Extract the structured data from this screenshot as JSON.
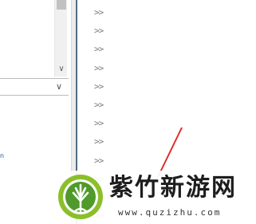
{
  "left_panel": {
    "scroll_down_glyph": "∨",
    "dropdown_arrow_glyph": "∨",
    "tiny_mark": "n"
  },
  "chevrons": [
    ">>",
    ">>",
    ">>",
    ">>",
    ">>",
    ">>",
    ">>",
    ">>",
    ">>",
    ">>",
    ">>",
    ">>"
  ],
  "watermark": {
    "name": "紫竹新游网",
    "url": "www.quzizhu.com"
  },
  "colors": {
    "divider": "#4e6c85",
    "red_line": "#e02a2a",
    "logo_green": "#8bbf2a",
    "logo_dark": "#2f6f1e"
  }
}
